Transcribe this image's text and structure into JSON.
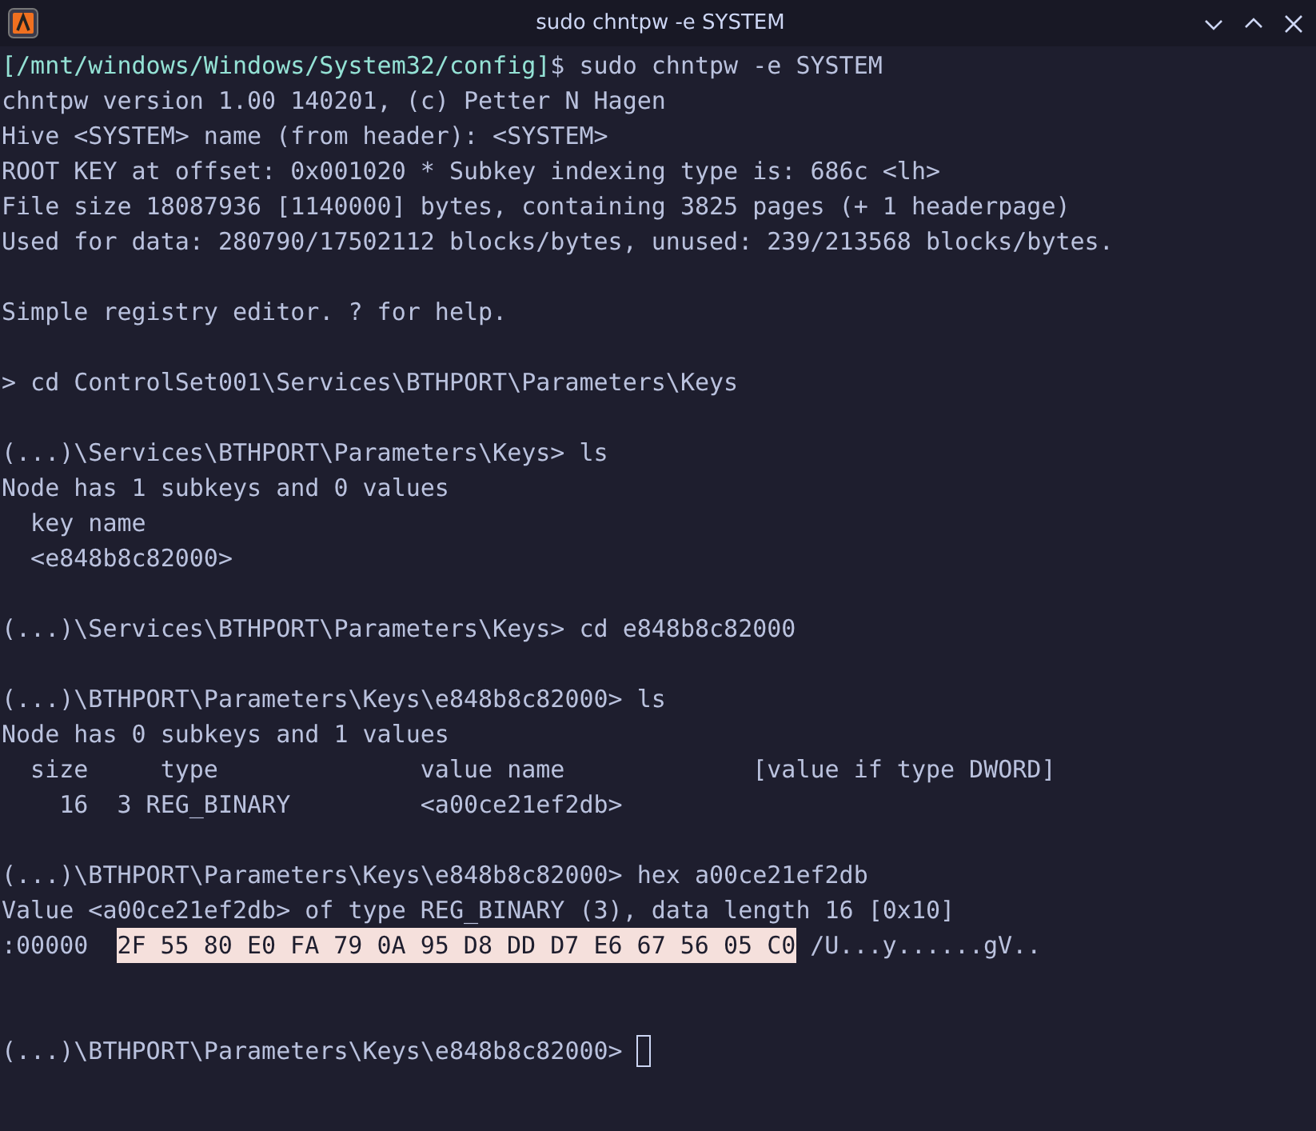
{
  "window": {
    "title": "sudo chntpw -e SYSTEM"
  },
  "terminal": {
    "lines": [
      {
        "kind": "prompt",
        "path": "[/mnt/windows/Windows/System32/config]",
        "command": "$ sudo chntpw -e SYSTEM"
      },
      {
        "kind": "output",
        "text": "chntpw version 1.00 140201, (c) Petter N Hagen"
      },
      {
        "kind": "output",
        "text": "Hive <SYSTEM> name (from header): <SYSTEM>"
      },
      {
        "kind": "output",
        "text": "ROOT KEY at offset: 0x001020 * Subkey indexing type is: 686c <lh>"
      },
      {
        "kind": "output",
        "text": "File size 18087936 [1140000] bytes, containing 3825 pages (+ 1 headerpage)"
      },
      {
        "kind": "output",
        "text": "Used for data: 280790/17502112 blocks/bytes, unused: 239/213568 blocks/bytes."
      },
      {
        "kind": "blank"
      },
      {
        "kind": "output",
        "text": "Simple registry editor. ? for help."
      },
      {
        "kind": "blank"
      },
      {
        "kind": "output",
        "text": "> cd ControlSet001\\Services\\BTHPORT\\Parameters\\Keys"
      },
      {
        "kind": "blank"
      },
      {
        "kind": "output",
        "text": "(...)\\Services\\BTHPORT\\Parameters\\Keys> ls"
      },
      {
        "kind": "output",
        "text": "Node has 1 subkeys and 0 values"
      },
      {
        "kind": "output",
        "text": "  key name"
      },
      {
        "kind": "output",
        "text": "  <e848b8c82000>"
      },
      {
        "kind": "blank"
      },
      {
        "kind": "output",
        "text": "(...)\\Services\\BTHPORT\\Parameters\\Keys> cd e848b8c82000"
      },
      {
        "kind": "blank"
      },
      {
        "kind": "output",
        "text": "(...)\\BTHPORT\\Parameters\\Keys\\e848b8c82000> ls"
      },
      {
        "kind": "output",
        "text": "Node has 0 subkeys and 1 values"
      },
      {
        "kind": "output",
        "text": "  size     type              value name             [value if type DWORD]"
      },
      {
        "kind": "output",
        "text": "    16  3 REG_BINARY         <a00ce21ef2db>"
      },
      {
        "kind": "blank"
      },
      {
        "kind": "output",
        "text": "(...)\\BTHPORT\\Parameters\\Keys\\e848b8c82000> hex a00ce21ef2db"
      },
      {
        "kind": "output",
        "text": "Value <a00ce21ef2db> of type REG_BINARY (3), data length 16 [0x10]"
      },
      {
        "kind": "hex",
        "offset": ":00000",
        "bytes": "2F 55 80 E0 FA 79 0A 95 D8 DD D7 E6 67 56 05 C0",
        "ascii": "/U...y......gV.."
      },
      {
        "kind": "blank"
      },
      {
        "kind": "blank"
      },
      {
        "kind": "cursor",
        "text": "(...)\\BTHPORT\\Parameters\\Keys\\e848b8c82000>"
      }
    ]
  }
}
